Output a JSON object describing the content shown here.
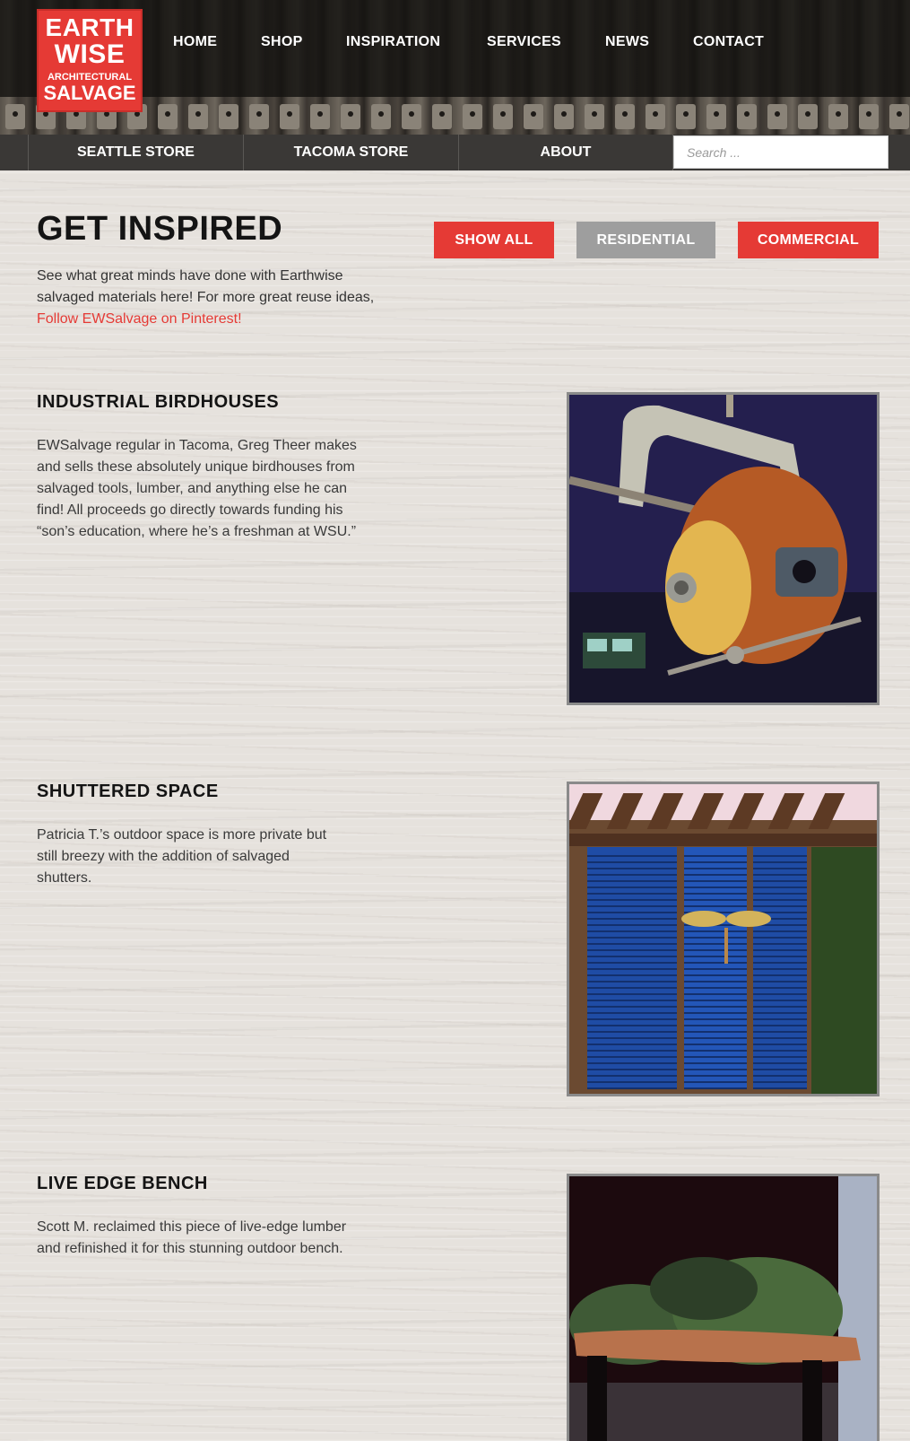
{
  "logo": {
    "line1": "EARTH",
    "line2": "WISE",
    "line3": "ARCHITECTURAL",
    "line4": "SALVAGE"
  },
  "main_nav": [
    "HOME",
    "SHOP",
    "INSPIRATION",
    "SERVICES",
    "NEWS",
    "CONTACT"
  ],
  "sub_nav": [
    "SEATTLE STORE",
    "TACOMA STORE",
    "ABOUT"
  ],
  "search": {
    "placeholder": "Search ..."
  },
  "page": {
    "title": "GET INSPIRED",
    "intro": "See what great minds have done with Earthwise salvaged materials here! For more great reuse ideas,",
    "pinterest_link": "Follow EWSalvage on Pinterest!"
  },
  "filters": [
    {
      "label": "SHOW ALL",
      "color": "#e53a35"
    },
    {
      "label": "RESIDENTIAL",
      "color": "#9e9e9e"
    },
    {
      "label": "COMMERCIAL",
      "color": "#e53a35"
    }
  ],
  "projects": [
    {
      "title": "INDUSTRIAL BIRDHOUSES",
      "description": "EWSalvage regular in Tacoma, Greg Theer makes and sells these absolutely unique birdhouses from salvaged tools, lumber, and anything else he can find! All proceeds go directly towards funding his “son’s education, where he’s a freshman at WSU.”"
    },
    {
      "title": "SHUTTERED SPACE",
      "description": "Patricia T.’s outdoor space is more private but still breezy with the addition of salvaged shutters."
    },
    {
      "title": "LIVE EDGE BENCH",
      "description": "Scott M. reclaimed this piece of live-edge lumber and refinished it for this stunning outdoor bench."
    }
  ],
  "colors": {
    "accent": "#e53a35",
    "nav_bar": "#3a3836",
    "secondary_button": "#9e9e9e"
  }
}
